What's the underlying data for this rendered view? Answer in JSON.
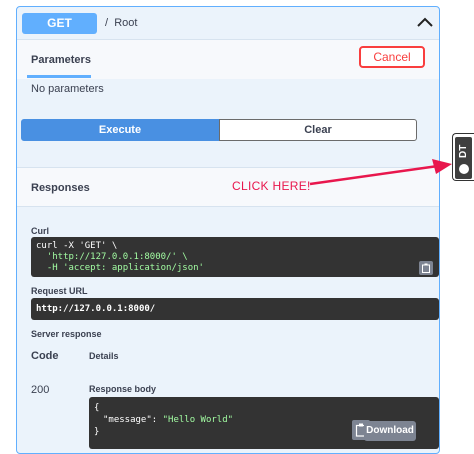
{
  "operation": {
    "method": "GET",
    "separator": "/",
    "path": "Root"
  },
  "parameters": {
    "tab_label": "Parameters",
    "cancel_label": "Cancel",
    "empty_text": "No parameters"
  },
  "actions": {
    "execute_label": "Execute",
    "clear_label": "Clear"
  },
  "responses": {
    "title": "Responses",
    "curl_label": "Curl",
    "curl_lines": [
      "curl -X 'GET' \\",
      "  'http://127.0.0.1:8000/' \\",
      "  -H 'accept: application/json'"
    ],
    "request_url_label": "Request URL",
    "request_url": "http://127.0.0.1:8000/",
    "server_response_label": "Server response",
    "code_header": "Code",
    "details_header": "Details",
    "status_code": "200",
    "response_body_label": "Response body",
    "body_open": "{",
    "body_key": "\"message\"",
    "body_colon": ": ",
    "body_value": "\"Hello World\"",
    "body_close": "}",
    "download_label": "Download"
  },
  "annotation": {
    "text": "CLICK HERE!",
    "color": "#e8174d"
  },
  "side_tab": {
    "label": "DT"
  },
  "colors": {
    "get_blue": "#61affe",
    "execute_blue": "#4990e2",
    "cancel_red": "#f93e3e",
    "code_bg": "#333333",
    "string_green": "#a2fca2"
  }
}
